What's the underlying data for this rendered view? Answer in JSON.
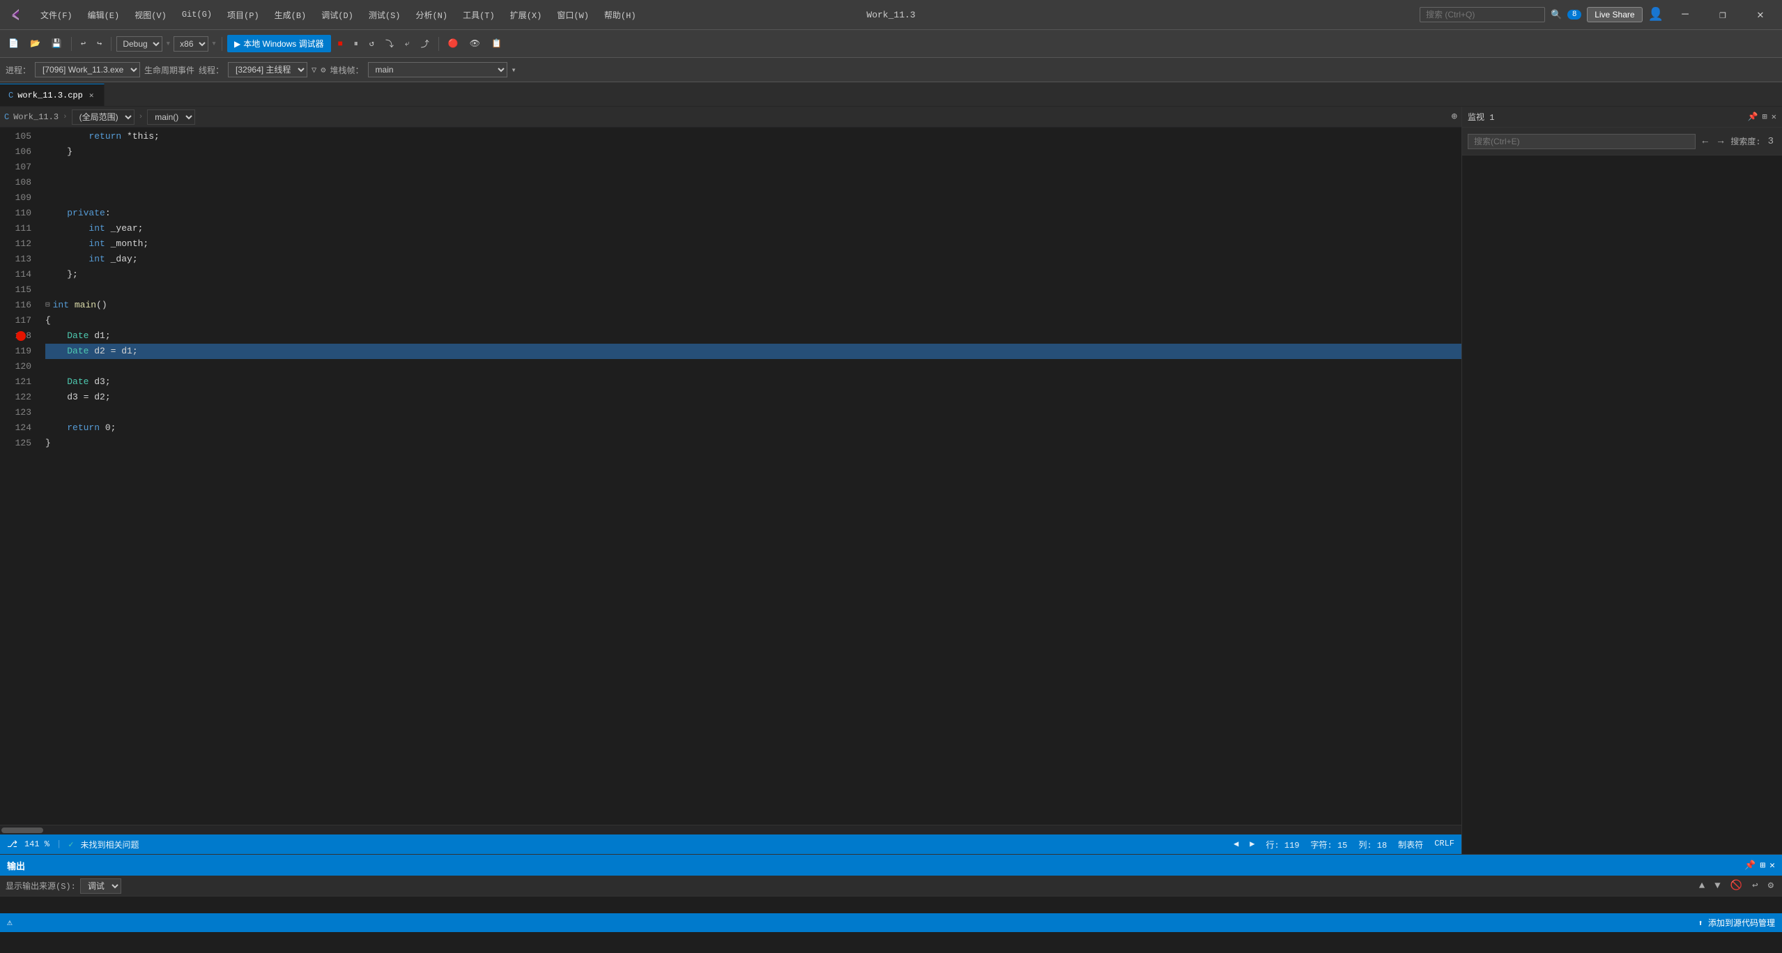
{
  "titlebar": {
    "menus": [
      {
        "label": "文件(F)",
        "id": "file"
      },
      {
        "label": "编辑(E)",
        "id": "edit"
      },
      {
        "label": "视图(V)",
        "id": "view"
      },
      {
        "label": "Git(G)",
        "id": "git"
      },
      {
        "label": "项目(P)",
        "id": "project"
      },
      {
        "label": "生成(B)",
        "id": "build"
      },
      {
        "label": "调试(D)",
        "id": "debug"
      },
      {
        "label": "测试(S)",
        "id": "test"
      },
      {
        "label": "分析(N)",
        "id": "analyze"
      },
      {
        "label": "工具(T)",
        "id": "tools"
      },
      {
        "label": "扩展(X)",
        "id": "extensions"
      },
      {
        "label": "窗口(W)",
        "id": "window"
      },
      {
        "label": "帮助(H)",
        "id": "help"
      }
    ],
    "title": "Work_11.3",
    "search_placeholder": "搜索 (Ctrl+Q)",
    "badge": "8",
    "live_share": "Live Share"
  },
  "toolbar": {
    "debug_config": "Debug",
    "platform": "x86",
    "run_label": "本地 Windows 调试器",
    "process": "进程：",
    "process_value": "[7096] Work_11.3.exe",
    "lifecycle": "生命周期事件",
    "thread_label": "线程：",
    "thread_value": "[32964] 主线程",
    "stackframe_label": "堆栈帧：",
    "stackframe_value": "main"
  },
  "tabs": [
    {
      "label": "work_11.3.cpp",
      "active": true,
      "id": "main"
    }
  ],
  "editor": {
    "file_breadcrumb": "Work_11.3",
    "scope": "(全局范围)",
    "function": "main()",
    "lines": [
      {
        "num": 105,
        "content": "        return *this;",
        "tokens": [
          {
            "text": "        return ",
            "class": "kw"
          },
          {
            "text": "*this;",
            "class": "plain"
          }
        ]
      },
      {
        "num": 106,
        "content": "    }",
        "tokens": [
          {
            "text": "    }",
            "class": "plain"
          }
        ]
      },
      {
        "num": 107,
        "content": "",
        "tokens": []
      },
      {
        "num": 108,
        "content": "",
        "tokens": []
      },
      {
        "num": 109,
        "content": "",
        "tokens": []
      },
      {
        "num": 110,
        "content": "    private:",
        "tokens": [
          {
            "text": "    ",
            "class": "plain"
          },
          {
            "text": "private",
            "class": "kw"
          },
          {
            "text": ":",
            "class": "plain"
          }
        ]
      },
      {
        "num": 111,
        "content": "        int _year;",
        "tokens": [
          {
            "text": "        ",
            "class": "plain"
          },
          {
            "text": "int",
            "class": "kw"
          },
          {
            "text": " _year;",
            "class": "plain"
          }
        ]
      },
      {
        "num": 112,
        "content": "        int _month;",
        "tokens": [
          {
            "text": "        ",
            "class": "plain"
          },
          {
            "text": "int",
            "class": "kw"
          },
          {
            "text": " _month;",
            "class": "plain"
          }
        ]
      },
      {
        "num": 113,
        "content": "        int _day;",
        "tokens": [
          {
            "text": "        ",
            "class": "plain"
          },
          {
            "text": "int",
            "class": "kw"
          },
          {
            "text": " _day;",
            "class": "plain"
          }
        ]
      },
      {
        "num": 114,
        "content": "    };",
        "tokens": [
          {
            "text": "    };",
            "class": "plain"
          }
        ]
      },
      {
        "num": 115,
        "content": "",
        "tokens": []
      },
      {
        "num": 116,
        "content": "int main()",
        "tokens": [
          {
            "text": "int",
            "class": "kw"
          },
          {
            "text": " ",
            "class": "plain"
          },
          {
            "text": "main",
            "class": "fn"
          },
          {
            "text": "()",
            "class": "plain"
          }
        ],
        "collapsible": true
      },
      {
        "num": 117,
        "content": "{",
        "tokens": [
          {
            "text": "{",
            "class": "plain"
          }
        ]
      },
      {
        "num": 118,
        "content": "    Date d1;",
        "tokens": [
          {
            "text": "    ",
            "class": "plain"
          },
          {
            "text": "Date",
            "class": "type"
          },
          {
            "text": " d1;",
            "class": "plain"
          }
        ],
        "breakpoint": true
      },
      {
        "num": 119,
        "content": "    Date d2 = d1;",
        "tokens": [
          {
            "text": "    ",
            "class": "plain"
          },
          {
            "text": "Date",
            "class": "type"
          },
          {
            "text": " d2 = d1;",
            "class": "plain"
          }
        ],
        "highlighted": true
      },
      {
        "num": 120,
        "content": "",
        "tokens": []
      },
      {
        "num": 121,
        "content": "    Date d3;",
        "tokens": [
          {
            "text": "    ",
            "class": "plain"
          },
          {
            "text": "Date",
            "class": "type"
          },
          {
            "text": " d3;",
            "class": "plain"
          }
        ]
      },
      {
        "num": 122,
        "content": "    d3 = d2;",
        "tokens": [
          {
            "text": "    d3 = d2;",
            "class": "plain"
          }
        ]
      },
      {
        "num": 123,
        "content": "",
        "tokens": []
      },
      {
        "num": 124,
        "content": "    return 0;",
        "tokens": [
          {
            "text": "    ",
            "class": "plain"
          },
          {
            "text": "return",
            "class": "kw"
          },
          {
            "text": " 0;",
            "class": "plain"
          }
        ]
      },
      {
        "num": 125,
        "content": "}",
        "tokens": [
          {
            "text": "}",
            "class": "plain"
          }
        ]
      }
    ]
  },
  "statusbar": {
    "zoom": "141 %",
    "issues": "未找到相关问题",
    "line": "行: 119",
    "col": "字符: 15",
    "col_num": "列: 18",
    "encoding": "制表符",
    "line_ending": "CRLF",
    "source_control": "添加到源代码管理"
  },
  "watch_panel": {
    "title": "监视 1",
    "search_placeholder": "搜索(Ctrl+E)",
    "search_label": "搜索度:",
    "search_value": "3"
  },
  "output_panel": {
    "title": "输出",
    "source_label": "显示输出来源(S):",
    "source_value": "调试"
  }
}
